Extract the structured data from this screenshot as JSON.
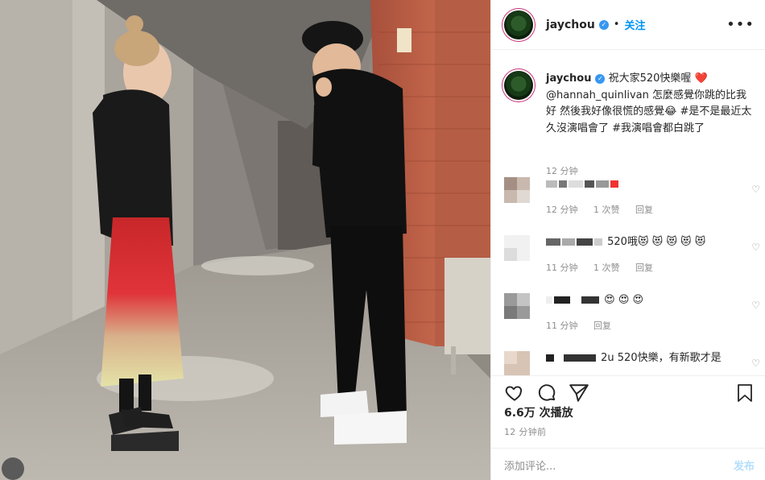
{
  "post": {
    "username": "jaychou",
    "follow_label": "关注",
    "more_label": "•••",
    "caption_text": "祝大家520快樂喔 ❤️ @hannah_quinlivan 怎麼感覺你跳的比我好 然後我好像很慌的感覺😂 #是不是最近太久沒演唱會了 #我演唱會都白跳了",
    "caption_time": "12 分钟"
  },
  "comments": [
    {
      "text": "",
      "time": "12 分钟",
      "likes": "1 次赞",
      "reply": "回复"
    },
    {
      "text": "520哦😻 😻 😻 😻 😻",
      "time": "11 分钟",
      "likes": "1 次赞",
      "reply": "回复"
    },
    {
      "text": "😍 😍 😍",
      "time": "11 分钟",
      "reply": "回复"
    },
    {
      "text": "2u 520快樂，有新歌才是"
    }
  ],
  "footer": {
    "views": "6.6万 次播放",
    "time": "12 分钟前",
    "add_comment_placeholder": "添加评论...",
    "post_label": "发布"
  },
  "colors": {
    "accent": "#0095f6",
    "muted": "#8e8e8e",
    "text": "#262626"
  },
  "icons": [
    "verified-icon",
    "more-icon",
    "heart-icon",
    "comment-icon",
    "share-icon",
    "bookmark-icon"
  ]
}
